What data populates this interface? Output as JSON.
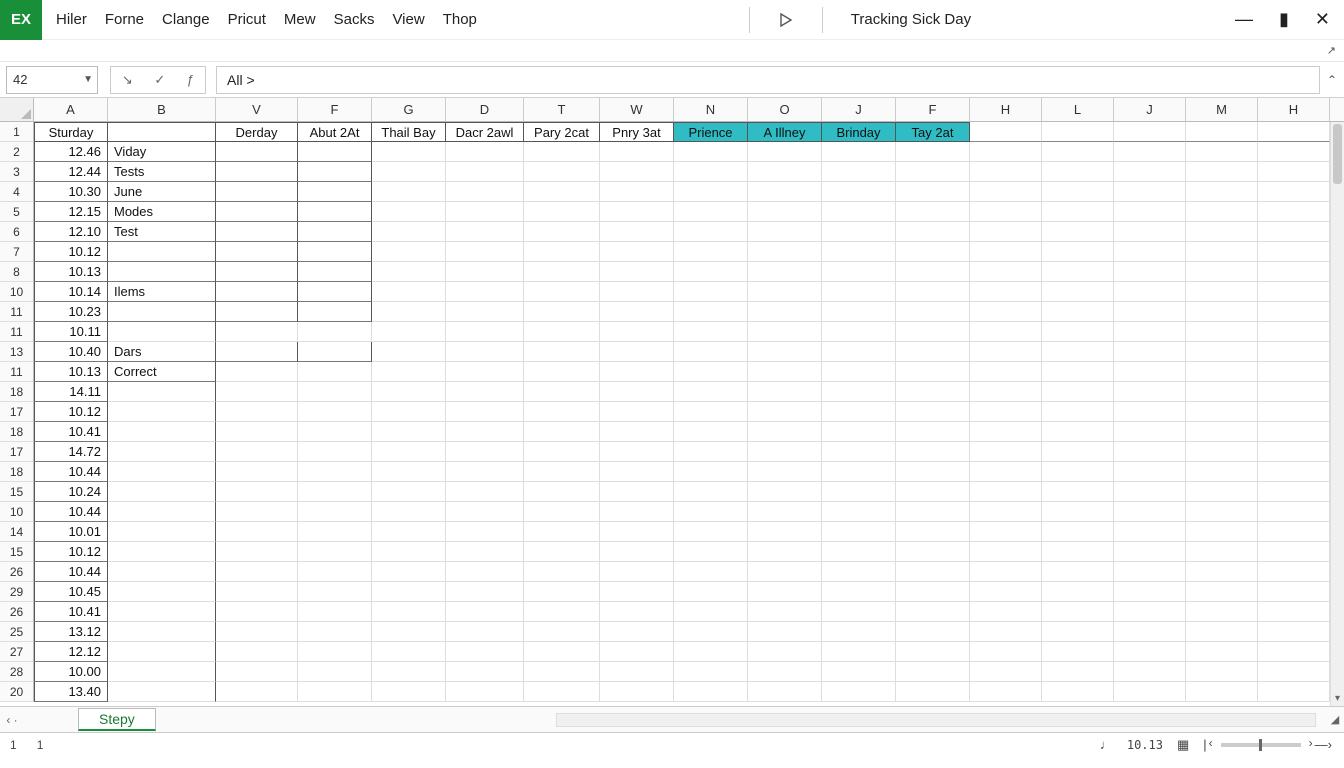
{
  "app_badge": "EX",
  "menu": [
    "Hiler",
    "Forne",
    "Clange",
    "Pricut",
    "Mew",
    "Sacks",
    "View",
    "Thop"
  ],
  "doc_title": "Tracking Sick Day",
  "window_controls": {
    "min": "—",
    "max": "▮",
    "close": "✕"
  },
  "namebox": "42",
  "formula_text": "All  >",
  "columns": [
    {
      "key": "A",
      "cls": "colA"
    },
    {
      "key": "B",
      "cls": "colB"
    },
    {
      "key": "V",
      "cls": "colV"
    },
    {
      "key": "F",
      "cls": "colF"
    },
    {
      "key": "G",
      "cls": "colG"
    },
    {
      "key": "D",
      "cls": "colD2"
    },
    {
      "key": "T",
      "cls": "colT"
    },
    {
      "key": "W",
      "cls": "colW"
    },
    {
      "key": "N",
      "cls": "colN"
    },
    {
      "key": "O",
      "cls": "colO"
    },
    {
      "key": "J",
      "cls": "colJ"
    },
    {
      "key": "F",
      "cls": "colF2"
    },
    {
      "key": "H",
      "cls": "colH"
    },
    {
      "key": "L",
      "cls": "colL"
    },
    {
      "key": "J",
      "cls": "colJJ"
    },
    {
      "key": "M",
      "cls": "colM"
    },
    {
      "key": "H",
      "cls": "colHH"
    }
  ],
  "header_cells": [
    "Sturday",
    "",
    "Derday",
    "Abut 2At",
    "Thail Bay",
    "Dacr 2awl",
    "Pary 2cat",
    "Pnry 3at",
    "Prience",
    "A Illney",
    "Brinday",
    "Tay 2at",
    "",
    "",
    "",
    "",
    ""
  ],
  "highlight_cols": [
    8,
    9,
    10,
    11
  ],
  "rows": [
    {
      "n": "1",
      "header": true
    },
    {
      "n": "2",
      "a": "12.46",
      "b": "Viday",
      "box": true
    },
    {
      "n": "3",
      "a": "12.44",
      "b": "Tests",
      "box": true
    },
    {
      "n": "4",
      "a": "10.30",
      "b": "June",
      "box": true
    },
    {
      "n": "5",
      "a": "12.15",
      "b": "Modes",
      "box": true
    },
    {
      "n": "6",
      "a": "12.10",
      "b": "Test",
      "box": true
    },
    {
      "n": "7",
      "a": "10.12",
      "b": "",
      "box": true
    },
    {
      "n": "8",
      "a": "10.13",
      "b": "",
      "box": true
    },
    {
      "n": "10",
      "a": "10.14",
      "b": "Ilems",
      "box": true
    },
    {
      "n": "11",
      "a": "10.23",
      "b": "",
      "box": true
    },
    {
      "n": "11",
      "a": "10.11",
      "b": "",
      "box": false
    },
    {
      "n": "13",
      "a": "10.40",
      "b": "Dars",
      "box": true,
      "boxV": true
    },
    {
      "n": "11",
      "a": "10.13",
      "b": "Correct",
      "box": false
    },
    {
      "n": "18",
      "a": "14.11",
      "b": ""
    },
    {
      "n": "17",
      "a": "10.12",
      "b": ""
    },
    {
      "n": "18",
      "a": "10.41",
      "b": ""
    },
    {
      "n": "17",
      "a": "14.72",
      "b": ""
    },
    {
      "n": "18",
      "a": "10.44",
      "b": ""
    },
    {
      "n": "15",
      "a": "10.24",
      "b": ""
    },
    {
      "n": "10",
      "a": "10.44",
      "b": ""
    },
    {
      "n": "14",
      "a": "10.01",
      "b": ""
    },
    {
      "n": "15",
      "a": "10.12",
      "b": ""
    },
    {
      "n": "26",
      "a": "10.44",
      "b": ""
    },
    {
      "n": "29",
      "a": "10.45",
      "b": ""
    },
    {
      "n": "26",
      "a": "10.41",
      "b": ""
    },
    {
      "n": "25",
      "a": "13.12",
      "b": ""
    },
    {
      "n": "27",
      "a": "12.12",
      "b": ""
    },
    {
      "n": "28",
      "a": "10.00",
      "b": ""
    },
    {
      "n": "20",
      "a": "13.40",
      "b": ""
    }
  ],
  "sheet_tab": "Stepy",
  "status": {
    "left1": "1",
    "left2": "1",
    "zoom": "10.13"
  }
}
